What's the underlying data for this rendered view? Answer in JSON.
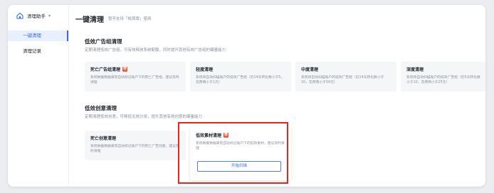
{
  "sidebar": {
    "app_name": "清理助手",
    "items": [
      {
        "label": "一键清理",
        "active": true
      },
      {
        "label": "清理记录",
        "active": false
      }
    ]
  },
  "header": {
    "title": "一键清理",
    "subtitle": "暂不支持「帐周版」使用"
  },
  "section_ad_groups": {
    "title": "低效广告组清理",
    "desc": "定期清理低效广告组，可有效释放系统配额，同时提升其他有效广告组的曝量能力",
    "cards": [
      {
        "title": "死亡广告组清理",
        "tag": "荐",
        "desc": "系统根据数据表现自动标记账户下的死亡广告组，建议及时清理"
      },
      {
        "title": "轻度清理",
        "tag": "",
        "desc": "系统将自动扫描账户的低效广告组（近14天转化数小于5，花费两小于1元）"
      },
      {
        "title": "中度清理",
        "tag": "",
        "desc": "系统将自动扫描账户的低效广告组（近14天转化数小于10，花费两小于50元）"
      },
      {
        "title": "深度清理",
        "tag": "",
        "desc": "系统将自动扫描账户的低效广告组（近5天转化数小于10，花费两小于25元）"
      }
    ]
  },
  "section_creatives": {
    "title": "低效创意清理",
    "desc": "定期清理低效创意，可降低无效分发，提升其他有效创意的曝量能力",
    "cards": [
      {
        "title": "死亡创意清理",
        "tag": "",
        "desc": "系统根据数据表现自动标记账户下的死亡广告创意，建议及时清理"
      },
      {
        "title": "低效素材清理",
        "tag": "荐",
        "desc": "系统根据数据表现自动标记账户下的低效素材，建议及时清理",
        "button": "开始扫描"
      }
    ]
  },
  "colors": {
    "accent": "#2f6bff",
    "highlight": "#e0281f",
    "tag": "#f2553b"
  }
}
